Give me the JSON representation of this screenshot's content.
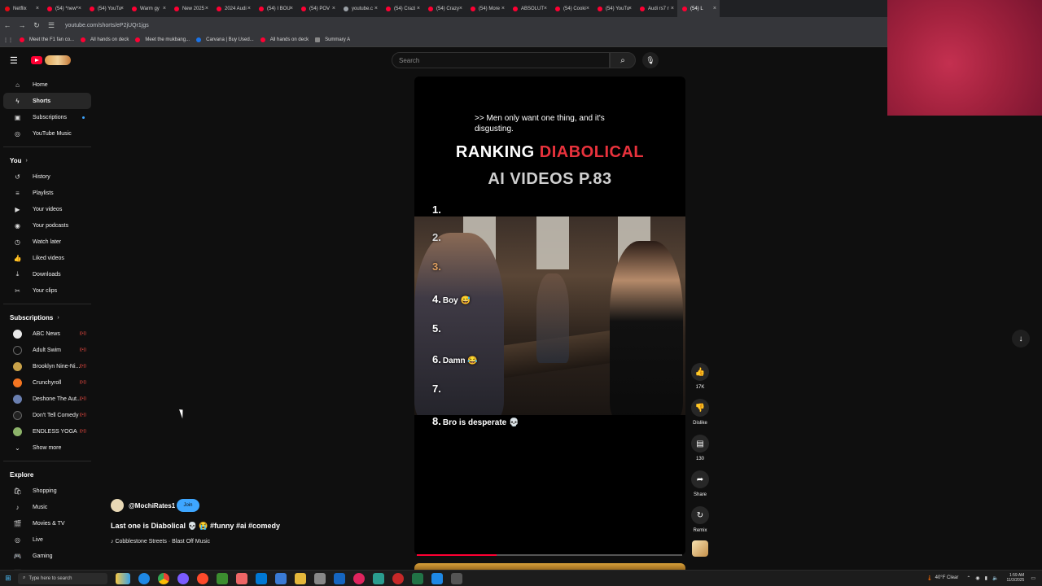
{
  "browser": {
    "tabs": [
      "Netflix",
      "(54) *new*",
      "(54) YouTu",
      "Warm gy",
      "New 2025",
      "2024 Audi",
      "(54) I BOU",
      "(54) POV",
      "youtube.c",
      "(54) Crazi",
      "(54) Crazy",
      "(54) More",
      "ABSOLUT",
      "(54) Cooki",
      "(54) YouTu",
      "Audi rs7 r",
      "(54) L"
    ],
    "url": "youtube.com/shorts/eP2jUQr1jgs",
    "bookmarks": [
      "Meet the F1 fan co...",
      "All hands on deck",
      "Meet the mukbang...",
      "Carvana | Buy Used...",
      "All hands on deck",
      "Summary A"
    ]
  },
  "header": {
    "search_placeholder": "Search"
  },
  "sidebar": {
    "main": [
      {
        "label": "Home",
        "icon": "home-icon"
      },
      {
        "label": "Shorts",
        "icon": "shorts-icon"
      },
      {
        "label": "Subscriptions",
        "icon": "subscriptions-icon"
      },
      {
        "label": "YouTube Music",
        "icon": "music-icon"
      }
    ],
    "you_heading": "You",
    "you": [
      {
        "label": "History",
        "icon": "history-icon"
      },
      {
        "label": "Playlists",
        "icon": "playlists-icon"
      },
      {
        "label": "Your videos",
        "icon": "your-videos-icon"
      },
      {
        "label": "Your podcasts",
        "icon": "podcasts-icon"
      },
      {
        "label": "Watch later",
        "icon": "watch-later-icon"
      },
      {
        "label": "Liked videos",
        "icon": "liked-icon"
      },
      {
        "label": "Downloads",
        "icon": "downloads-icon"
      },
      {
        "label": "Your clips",
        "icon": "clips-icon"
      }
    ],
    "subscriptions_heading": "Subscriptions",
    "subscriptions": [
      {
        "label": "ABC News",
        "color": "#e9e9e9"
      },
      {
        "label": "Adult Swim",
        "color": "#111111"
      },
      {
        "label": "Brooklyn Nine-Ni...",
        "color": "#c9a24a"
      },
      {
        "label": "Crunchyroll",
        "color": "#f47521"
      },
      {
        "label": "Deshone The Aut...",
        "color": "#6a7fb0"
      },
      {
        "label": "Don't Tell Comedy",
        "color": "#222222"
      },
      {
        "label": "ENDLESS YOGA",
        "color": "#8db36a"
      }
    ],
    "show_more": "Show more",
    "explore_heading": "Explore",
    "explore": [
      {
        "label": "Shopping",
        "icon": "shopping-icon"
      },
      {
        "label": "Music",
        "icon": "music-note-icon"
      },
      {
        "label": "Movies & TV",
        "icon": "movies-icon"
      },
      {
        "label": "Live",
        "icon": "live-icon"
      },
      {
        "label": "Gaming",
        "icon": "gaming-icon"
      },
      {
        "label": "News",
        "icon": "news-icon"
      }
    ]
  },
  "short": {
    "caption": ">> Men only want one thing, and it's disgusting.",
    "title_white": "RANKING ",
    "title_red": "DIABOLICAL",
    "title_line2": "AI VIDEOS P.83",
    "ranks": [
      {
        "n": "1.",
        "label": ""
      },
      {
        "n": "2.",
        "label": ""
      },
      {
        "n": "3.",
        "label": ""
      },
      {
        "n": "4.",
        "label": "Boy 😅"
      },
      {
        "n": "5.",
        "label": ""
      },
      {
        "n": "6.",
        "label": "Damn 😂"
      },
      {
        "n": "7.",
        "label": ""
      },
      {
        "n": "8.",
        "label": "Bro is desperate 💀"
      }
    ],
    "progress_fraction": 0.3
  },
  "actions": {
    "like_count": "17K",
    "dislike_label": "Dislike",
    "comments_count": "130",
    "share_label": "Share",
    "remix_label": "Remix"
  },
  "video_info": {
    "channel": "@MochiRates1",
    "join": "Join",
    "title": "Last one is Diabolical 💀 😭 #funny #ai #comedy",
    "music": "♪ Cobblestone Streets · Blast Off Music"
  },
  "taskbar": {
    "search_placeholder": "Type here to search",
    "weather": "40°F  Clear",
    "time": "1:59 AM",
    "date": "11/3/2025"
  }
}
